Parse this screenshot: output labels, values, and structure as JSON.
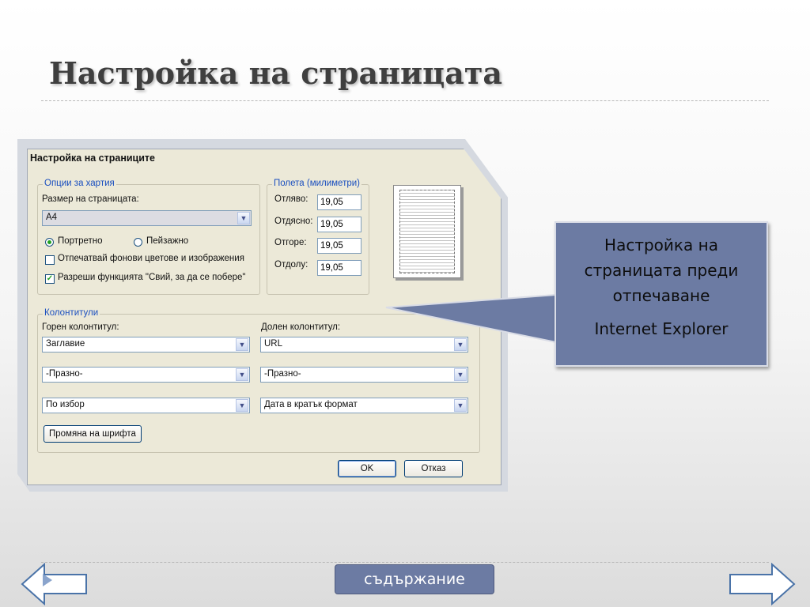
{
  "slide": {
    "title": "Настройка на страницата",
    "toc_label": "съдържание"
  },
  "callout": {
    "text": "Настройка на страницата преди отпечаване",
    "subtext": "Internet Explorer"
  },
  "dialog": {
    "title": "Настройка на страниците",
    "paper": {
      "legend": "Опции за хартия",
      "size_label": "Размер на страницата:",
      "size_value": "A4",
      "portrait_label": "Портретно",
      "landscape_label": "Пейзажно",
      "orientation": "portrait",
      "bg_label": "Отпечатвай фонови цветове и изображения",
      "bg_checked": false,
      "shrink_label": "Разреши функцията \"Свий, за да се побере\"",
      "shrink_checked": true
    },
    "margins": {
      "legend": "Полета (милиметри)",
      "left_label": "Отляво:",
      "left_value": "19,05",
      "right_label": "Отдясно:",
      "right_value": "19,05",
      "top_label": "Отгоре:",
      "top_value": "19,05",
      "bottom_label": "Отдолу:",
      "bottom_value": "19,05"
    },
    "headers": {
      "legend": "Колонтитули",
      "header_label": "Горен колонтитул:",
      "footer_label": "Долен колонтитул:",
      "header1": "Заглавие",
      "header2": "-Празно-",
      "header3": "По избор",
      "footer1": "URL",
      "footer2": "-Празно-",
      "footer3": "Дата в кратък формат",
      "font_button": "Промяна на шрифта"
    },
    "ok_label": "OK",
    "cancel_label": "Отказ"
  },
  "colors": {
    "accent": "#6c7ba3",
    "legend_blue": "#1a4fbf",
    "dialog_bg": "#ece9d8"
  }
}
